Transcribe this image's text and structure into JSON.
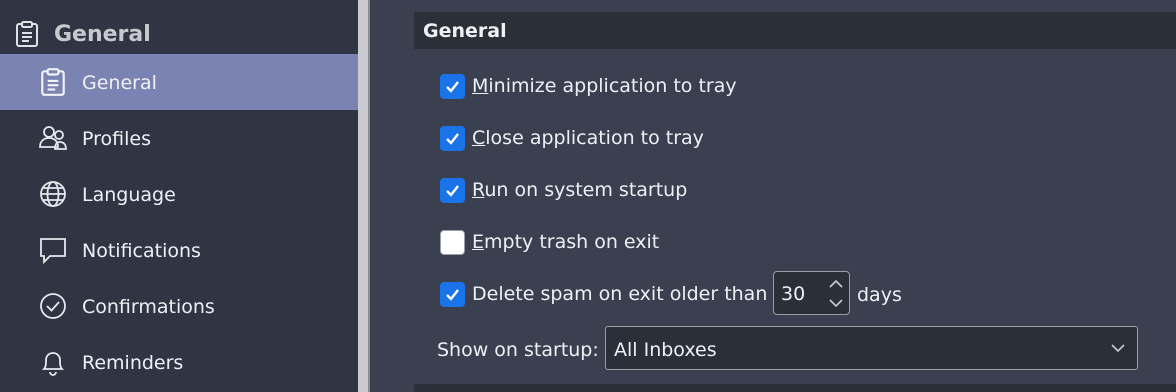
{
  "sidebar": {
    "group": {
      "label": "General",
      "icon": "clipboard-icon"
    },
    "items": [
      {
        "label": "General",
        "icon": "clipboard-icon",
        "selected": true
      },
      {
        "label": "Profiles",
        "icon": "users-icon"
      },
      {
        "label": "Language",
        "icon": "globe-icon"
      },
      {
        "label": "Notifications",
        "icon": "speech-bubble-icon"
      },
      {
        "label": "Confirmations",
        "icon": "check-circle-icon"
      },
      {
        "label": "Reminders",
        "icon": "bell-icon"
      }
    ]
  },
  "main": {
    "section_title": "General",
    "options": [
      {
        "mnemonic": "M",
        "rest": "inimize application to tray",
        "checked": true
      },
      {
        "mnemonic": "C",
        "rest": "lose application to tray",
        "checked": true
      },
      {
        "mnemonic": "R",
        "rest": "un on system startup",
        "checked": true
      },
      {
        "mnemonic": "E",
        "rest": "mpty trash on exit",
        "checked": false
      },
      {
        "mnemonic": "",
        "rest": "Delete spam on exit older than",
        "checked": true
      }
    ],
    "spam_days": {
      "value": "30",
      "unit": "days"
    },
    "startup": {
      "label": "Show on startup:",
      "value": "All Inboxes"
    }
  },
  "colors": {
    "accent": "#1a73e8",
    "selected_item": "#7b83b3",
    "sidebar_bg": "#303544",
    "content_bg": "#3b4050"
  }
}
